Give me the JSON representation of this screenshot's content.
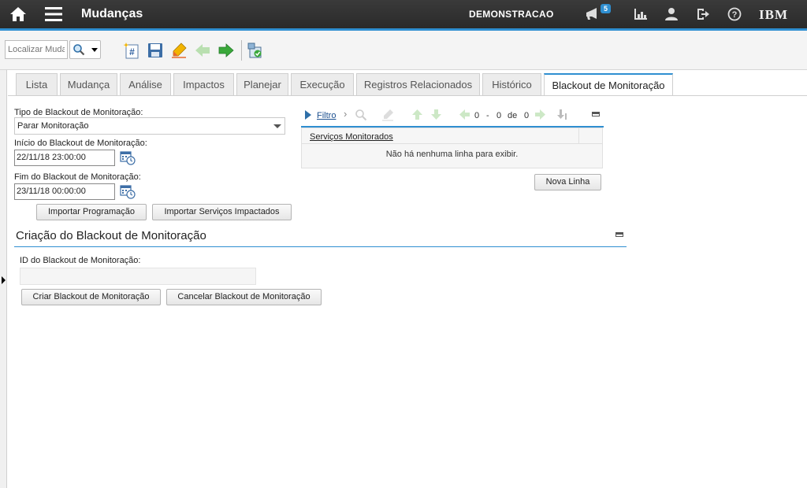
{
  "header": {
    "app_title": "Mudanças",
    "org_label": "DEMONSTRACAO",
    "notification_count": "5",
    "brand": "IBM"
  },
  "toolbar": {
    "find_placeholder": "Localizar Mudança",
    "icons": [
      "new-record-icon",
      "save-icon",
      "clear-changes-icon",
      "previous-record-icon",
      "next-record-icon",
      "workflow-icon"
    ]
  },
  "tabs": [
    {
      "label": "Lista",
      "active": false
    },
    {
      "label": "Mudança",
      "active": false
    },
    {
      "label": "Análise",
      "active": false
    },
    {
      "label": "Impactos",
      "active": false
    },
    {
      "label": "Planejar",
      "active": false
    },
    {
      "label": "Execução",
      "active": false
    },
    {
      "label": "Registros Relacionados",
      "active": false
    },
    {
      "label": "Histórico",
      "active": false
    },
    {
      "label": "Blackout de Monitoração",
      "active": true
    }
  ],
  "form": {
    "type_label": "Tipo de Blackout de Monitoração:",
    "type_value": "Parar Monitoração",
    "start_label": "Início do Blackout de Monitoração:",
    "start_value": "22/11/18 23:00:00",
    "end_label": "Fim do Blackout de Monitoração:",
    "end_value": "23/11/18 00:00:00",
    "import_schedule_label": "Importar Programação",
    "import_services_label": "Importar Serviços Impactados"
  },
  "table": {
    "filter_label": "Filtro",
    "pager_start": "0",
    "pager_dash": "-",
    "pager_end": "0",
    "pager_of": "de",
    "pager_total": "0",
    "column_header": "Serviços Monitorados",
    "empty_message": "Não há nenhuma linha para exibir.",
    "new_row_label": "Nova Linha"
  },
  "creation": {
    "title": "Criação do Blackout de Monitoração",
    "id_label": "ID do Blackout de Monitoração:",
    "id_value": "",
    "create_label": "Criar Blackout de Monitoração",
    "cancel_label": "Cancelar Blackout de Monitoração"
  },
  "colors": {
    "accent": "#2f8fd1",
    "topbar": "#2f2f2f",
    "arrow_green": "#3aa83a"
  }
}
